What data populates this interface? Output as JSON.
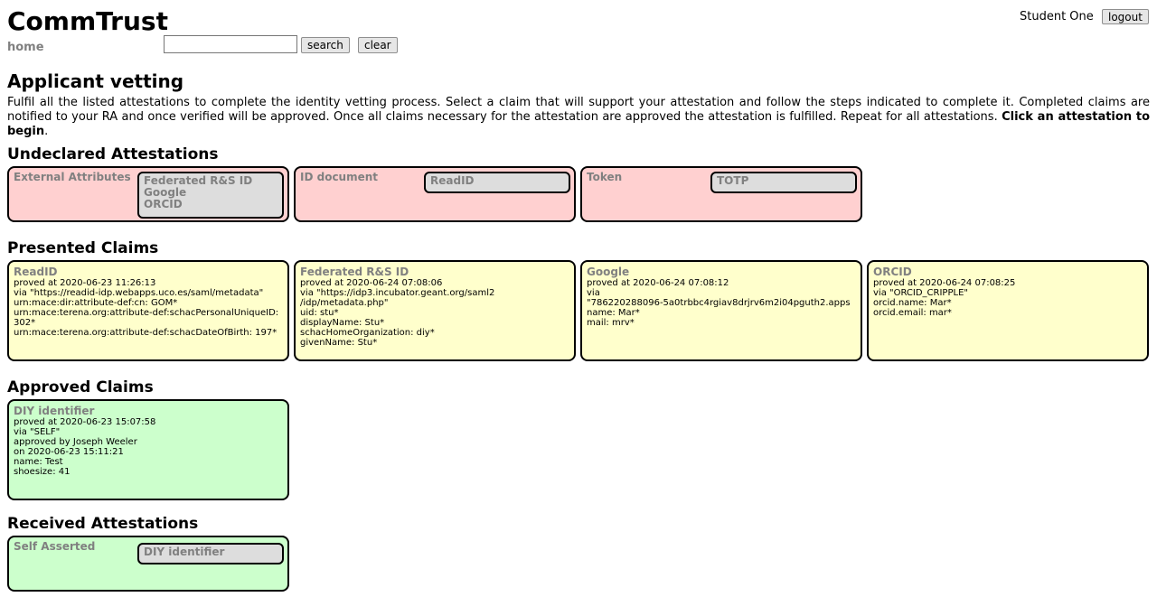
{
  "app": {
    "title": "CommTrust"
  },
  "header": {
    "home_label": "home",
    "search_value": "",
    "search_label": "search",
    "clear_label": "clear",
    "user_name": "Student One",
    "logout_label": "logout"
  },
  "page": {
    "title": "Applicant vetting",
    "intro": "Fulfil all the listed attestations to complete the identity vetting process. Select a claim that will support your attestation and follow the steps indicated to complete it. Completed claims are notified to your RA and once verified will be approved. Once all claims necessary for the attestation are approved the attestation is fulfilled. Repeat for all attestations. ",
    "intro_bold": "Click an attestation to begin",
    "intro_end": "."
  },
  "undeclared": {
    "title": "Undeclared Attestations",
    "cards": [
      {
        "name": "External Attributes",
        "claims": [
          "Federated R&S ID",
          "Google",
          "ORCID"
        ]
      },
      {
        "name": "ID document",
        "claims": [
          "ReadID"
        ]
      },
      {
        "name": "Token",
        "claims": [
          "TOTP"
        ]
      }
    ]
  },
  "presented": {
    "title": "Presented Claims",
    "cards": [
      {
        "name": "ReadID",
        "lines": [
          "proved at 2020-06-23 11:26:13",
          "via \"https://readid-idp.webapps.uco.es/saml/metadata\"",
          "urn:mace:dir:attribute-def:cn: GOM*",
          "urn:mace:terena.org:attribute-def:schacPersonalUniqueID:",
          "302*",
          "urn:mace:terena.org:attribute-def:schacDateOfBirth: 197*"
        ]
      },
      {
        "name": "Federated R&S ID",
        "lines": [
          "proved at 2020-06-24 07:08:06",
          "via \"https://idp3.incubator.geant.org/saml2",
          "/idp/metadata.php\"",
          "uid: stu*",
          "displayName: Stu*",
          "schacHomeOrganization: diy*",
          "givenName: Stu*"
        ]
      },
      {
        "name": "Google",
        "lines": [
          "proved at 2020-06-24 07:08:12",
          "via",
          "\"786220288096-5a0trbbc4rgiav8drjrv6m2i04pguth2.apps",
          "name: Mar*",
          "mail: mrv*"
        ]
      },
      {
        "name": "ORCID",
        "lines": [
          "proved at 2020-06-24 07:08:25",
          "via \"ORCID_CRIPPLE\"",
          "orcid.name: Mar*",
          "orcid.email: mar*"
        ]
      }
    ]
  },
  "approved": {
    "title": "Approved Claims",
    "cards": [
      {
        "name": "DIY identifier",
        "lines": [
          "proved at 2020-06-23 15:07:58",
          "via \"SELF\"",
          "approved by Joseph Weeler",
          "on 2020-06-23 15:11:21",
          "name: Test",
          "shoesize: 41"
        ]
      }
    ]
  },
  "received": {
    "title": "Received Attestations",
    "cards": [
      {
        "name": "Self Asserted",
        "claims": [
          "DIY identifier"
        ]
      }
    ]
  }
}
